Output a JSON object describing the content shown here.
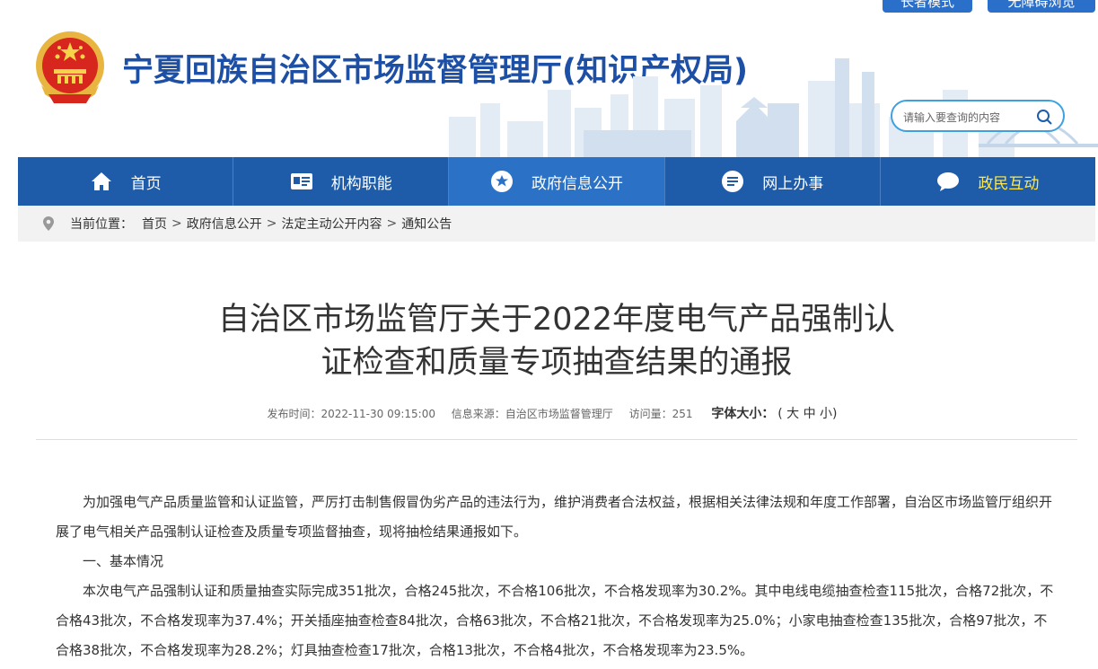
{
  "top_buttons": [
    "长者模式",
    "无障碍浏览"
  ],
  "header": {
    "site_title": "宁夏回族自治区市场监督管理厅(知识产权局)",
    "search_placeholder": "请输入要查询的内容"
  },
  "nav": {
    "items": [
      {
        "label": "首页",
        "icon": "home-icon"
      },
      {
        "label": "机构职能",
        "icon": "id-card-icon"
      },
      {
        "label": "政府信息公开",
        "icon": "star-circle-icon"
      },
      {
        "label": "网上办事",
        "icon": "list-circle-icon"
      },
      {
        "label": "政民互动",
        "icon": "chat-bubble-icon"
      }
    ],
    "active_index": 2,
    "highlight_index": 4
  },
  "breadcrumb": {
    "prefix": "当前位置：",
    "items": [
      "首页",
      "政府信息公开",
      "法定主动公开内容",
      "通知公告"
    ],
    "separator": ">"
  },
  "article": {
    "title_line1": "自治区市场监管厅关于2022年度电气产品强制认",
    "title_line2": "证检查和质量专项抽查结果的通报",
    "meta": {
      "publish_time": "发布时间：2022-11-30 09:15:00",
      "source": "信息来源：自治区市场监督管理厅",
      "visits": "访问量：251",
      "font_size_label": "字体大小：",
      "font_size_options": "( 大 中 小)"
    },
    "paragraphs": [
      "为加强电气产品质量监管和认证监管，严厉打击制售假冒伪劣产品的违法行为，维护消费者合法权益，根据相关法律法规和年度工作部署，自治区市场监管厅组织开展了电气相关产品强制认证检查及质量专项监督抽查，现将抽检结果通报如下。",
      "一、基本情况",
      "本次电气产品强制认证和质量抽查实际完成351批次，合格245批次，不合格106批次，不合格发现率为30.2%。其中电线电缆抽查检查115批次，合格72批次，不合格43批次，不合格发现率为37.4%；开关插座抽查检查84批次，合格63批次，不合格21批次，不合格发现率为25.0%；小家电抽查检查135批次，合格97批次，不合格38批次，不合格发现率为28.2%；灯具抽查检查17批次，合格13批次，不合格4批次，不合格发现率为23.5%。"
    ]
  },
  "colors": {
    "nav_bg": "#1e5ba8",
    "nav_active": "#2b72c6",
    "title_blue": "#1d4fa5",
    "highlight_yellow": "#ffe84d"
  }
}
